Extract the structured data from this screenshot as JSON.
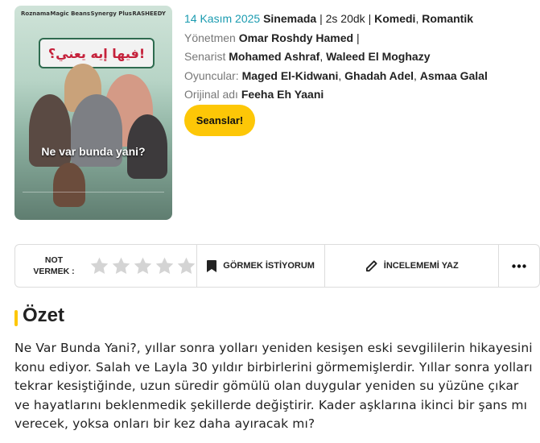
{
  "movie": {
    "release_date": "14 Kasım 2025",
    "status": "Sinemada",
    "duration": "2s 20dk",
    "genres": [
      "Komedi",
      "Romantik"
    ],
    "director_label": "Yönetmen",
    "director": "Omar Roshdy Hamed",
    "writer_label": "Senarist",
    "writers": [
      "Mohamed Ashraf",
      "Waleed El Moghazy"
    ],
    "cast_label": "Oyuncular:",
    "cast": [
      "Maged El-Kidwani",
      "Ghadah Adel",
      "Asmaa Galal"
    ],
    "original_title_label": "Orijinal adı",
    "original_title": "Feeha Eh Yaani",
    "showtimes_button": "Seanslar!"
  },
  "poster": {
    "brands": [
      "Roznama",
      "Magic Beans",
      "Synergy Plus",
      "RASHEEDY"
    ],
    "arabic_title": "فيها إيه يعني؟!",
    "turkish_title": "Ne var bunda yani?"
  },
  "actions": {
    "rate_label_line1": "NOT",
    "rate_label_line2": "VERMEK :",
    "star_count": 5,
    "rating": 0,
    "watchlist_label": "GÖRMEK İSTİYORUM",
    "review_label": "İNCELEMEMİ YAZ",
    "more_icon": "more-horizontal-icon"
  },
  "summary": {
    "title": "Özet",
    "text": "Ne Var Bunda Yani?, yıllar sonra yolları yeniden kesişen eski sevgililerin hikayesini konu ediyor. Salah ve Layla 30 yıldır birbirlerini görmemişlerdir. Yıllar sonra yolları tekrar kesiştiğinde, uzun süredir gömülü olan duygular yeniden su yüzüne çıkar ve hayatlarını beklenmedik şekillerde değiştirir. Kader aşklarına ikinci bir şans mı verecek, yoksa onları bir kez daha ayıracak mı?"
  },
  "colors": {
    "accent": "#fdc707",
    "link": "#1a9bb0",
    "star_empty": "#d4d4d4"
  }
}
